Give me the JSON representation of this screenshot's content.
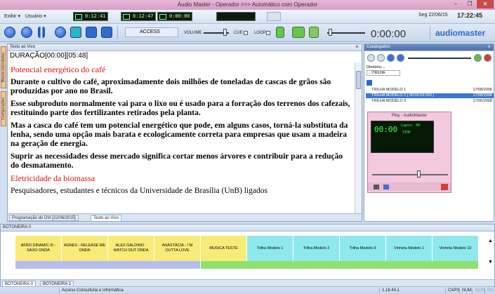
{
  "window": {
    "title": "Áudio Master - Operador >>> Automático com Operador",
    "controls": [
      "−",
      "❐",
      "✕"
    ]
  },
  "menubar": {
    "exibir": "Exibir ▾",
    "usuario": "Usuário ▾"
  },
  "timers": {
    "t1": "0:12:41",
    "t2": "0:12:47",
    "t3": "0:00:00"
  },
  "datetime": "Seg 22/06/15",
  "clock": "17:22:45",
  "toolbar": {
    "access_label": "ACCESS",
    "volume_label": "VOLUME",
    "cue_label": "CUE",
    "loop_label": "LOOP",
    "time": "0:00:00",
    "brand": "audiomaster"
  },
  "vtabs": [
    "Blocos executados",
    "Configurações"
  ],
  "textpanel": {
    "title": "Texto ao Vivo",
    "duration": "DURAÇÃO[00:00][05:48]",
    "heading1": "Potencial energético do café",
    "p1": "Durante o cultivo do café, aproximadamente dois milhões de toneladas de cascas de grãos são produzidas por ano no Brasil.",
    "p2": "Esse subproduto normalmente vai para o lixo ou é usado para a forração dos terrenos dos cafezais, restituindo parte dos fertilizantes retirados pela planta.",
    "p3": "Mas a casca do café tem um potencial energético que pode, em alguns casos, torná-la substituta da lenha, sendo uma opção mais barata e ecologicamente correta para empresas que usam a madeira na geração de energia.",
    "p4": "Suprir as necessidades desse mercado significa cortar menos árvores e contribuir para a redução do desmatamento.",
    "heading2": "Eletricidade da biomassa",
    "p5": "Pesquisadores, estudantes e técnicos da Universidade de Brasília (UnB) ligados",
    "tabs": [
      "Programação do DIA [22/06/2015]",
      "Texto ao Vivo"
    ]
  },
  "catalog": {
    "title": "Catalogados",
    "dir_label": "Diretório....",
    "dir_value": "...\\TRILHA",
    "rows": [
      {
        "name": "TRILHA MODELO 1",
        "date": "17/08/2006"
      },
      {
        "name": "TRILHA MODELO 2 [ 00:00:53:053 ]",
        "date": "17/08/2006"
      },
      {
        "name": "TRILHA MODELO 3",
        "date": "17/06/2008"
      }
    ],
    "player": {
      "title": "Play - AudioMaster",
      "display_top": "Lapso: 00",
      "mode": "STOP",
      "time": "00:00"
    }
  },
  "botoneira": {
    "title": "BOTONEIRA 0",
    "buttons": [
      "AFRO DINAMIC III - SAXO ONDA",
      "AGNES - RELEASE ME ONDA",
      "ALEX GALDINO - WATCH OUT ONDA",
      "ANASTÁCIA - I`M OUTTA LOVE",
      "MUSICA TESTE",
      "Trilha Modelo 1",
      "Trilha Modelo 2",
      "Trilha Modelo 3",
      "Vinheta Modelo 1",
      "Vinheta Modelo 10"
    ],
    "tabs": [
      "BOTONEIRA 0",
      "BOTONEIRA 1"
    ]
  },
  "status": {
    "company": "Access Consultoria e Informática",
    "version": "1.18.43.1",
    "caps": "CAPS",
    "num": "NUM",
    "scrl": "SCRL",
    "ins": "INS"
  },
  "colors": {
    "yellow": "#f7ec7a",
    "green": "#a7e87a",
    "cyan": "#8ee9ec",
    "bar_blue": "#b6bcf0",
    "bar_green": "#8fe26c"
  }
}
